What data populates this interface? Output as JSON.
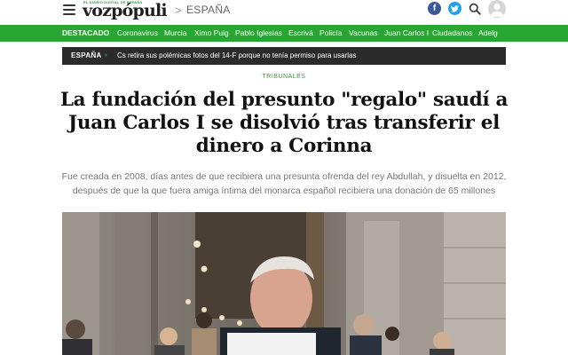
{
  "header": {
    "logo": "vozpópuli",
    "logo_tagline": "EL DIARIO DIGITAL DE ESPAÑA",
    "breadcrumb_separator": ">",
    "section": "ESPAÑA",
    "facebook_glyph": "f",
    "icons": [
      "menu-icon",
      "facebook-icon",
      "twitter-icon",
      "search-icon",
      "user-icon"
    ]
  },
  "nav": {
    "featured_label": "DESTACADO",
    "items": [
      "Coronavirus",
      "Murcia",
      "Ximo Puig",
      "Pablo Iglesias",
      "Escrivá",
      "Policía",
      "Vacunas",
      "Juan Carlos I",
      "Ciudadanos",
      "Adelg"
    ]
  },
  "ticker": {
    "label": "ESPAÑA",
    "separator": "›",
    "text": "Cs retira sus polémicas fotos del 14-F porque no tenía permiso para usarlas"
  },
  "article": {
    "category": "TRIBUNALES",
    "headline": "La fundación del presunto \"regalo\" saudí a Juan Carlos I se disolvió tras transferir el dinero a Corinna",
    "subtitle": "Fue creada en 2008, días antes de que recibiera una presunta ofrenda del rey Abdullah, y disuelta en 2012, después de que la que fuera amiga íntima del monarca español recibiera una donación de 65 millones"
  },
  "colors": {
    "brand_green": "#27a632",
    "ticker_bg": "#2b2b2b",
    "facebook": "#3b5998",
    "twitter": "#1da1f2"
  }
}
